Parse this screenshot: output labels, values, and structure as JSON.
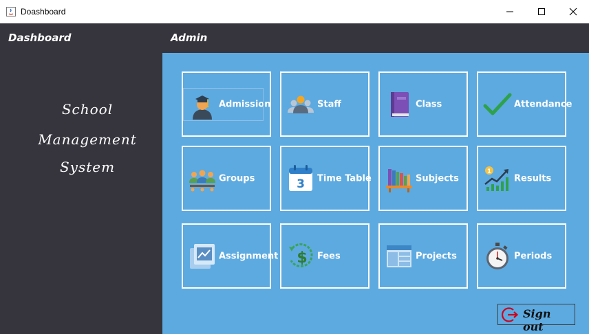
{
  "window": {
    "title": "Doashboard"
  },
  "header": {
    "left_label": "Dashboard",
    "right_label": "Admin"
  },
  "sidebar": {
    "lines": [
      "School",
      "Management",
      "System"
    ]
  },
  "tiles": [
    {
      "label": "Admission",
      "icon": "graduate-icon"
    },
    {
      "label": "Staff",
      "icon": "people-icon"
    },
    {
      "label": "Class",
      "icon": "book-icon"
    },
    {
      "label": "Attendance",
      "icon": "checkmark-icon"
    },
    {
      "label": "Groups",
      "icon": "group-icon"
    },
    {
      "label": "Time Table",
      "icon": "calendar-icon",
      "icon_text": "3"
    },
    {
      "label": "Subjects",
      "icon": "bookshelf-icon"
    },
    {
      "label": "Results",
      "icon": "growth-chart-icon",
      "icon_text": "1"
    },
    {
      "label": "Assignment",
      "icon": "chart-document-icon"
    },
    {
      "label": "Fees",
      "icon": "dollar-icon",
      "icon_text": "$"
    },
    {
      "label": "Projects",
      "icon": "table-layout-icon"
    },
    {
      "label": "Periods",
      "icon": "stopwatch-icon"
    }
  ],
  "signout": {
    "label": "Sign out"
  }
}
